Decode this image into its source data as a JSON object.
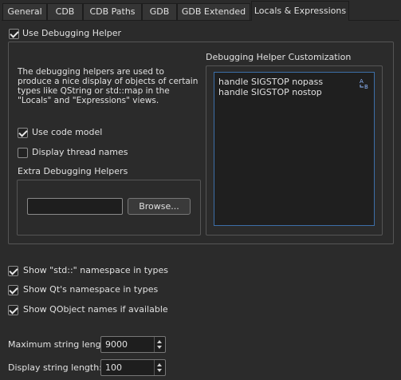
{
  "tabs": [
    {
      "label": "General"
    },
    {
      "label": "CDB"
    },
    {
      "label": "CDB Paths"
    },
    {
      "label": "GDB"
    },
    {
      "label": "GDB Extended"
    },
    {
      "label": "Locals & Expressions"
    }
  ],
  "active_tab": "Locals & Expressions",
  "use_debugging_helper": {
    "label": "Use Debugging Helper",
    "checked": true
  },
  "helpers": {
    "description": "The debugging helpers are used to produce a nice display of objects of certain types like QString or std::map in the \"Locals\" and \"Expressions\" views.",
    "use_code_model": {
      "label": "Use code model",
      "checked": true
    },
    "display_thread_names": {
      "label": "Display thread names",
      "checked": false
    },
    "extra_title": "Extra Debugging Helpers",
    "extra_path_value": "",
    "browse_label": "Browse..."
  },
  "customization": {
    "title": "Debugging Helper Customization",
    "lines": [
      "handle SIGSTOP nopass",
      "handle SIGSTOP nostop"
    ],
    "corner_icon": "text-reorder-icon"
  },
  "options": [
    {
      "label": "Show \"std::\" namespace in types",
      "checked": true
    },
    {
      "label": "Show Qt's namespace in types",
      "checked": true
    },
    {
      "label": "Show QObject names if available",
      "checked": true
    }
  ],
  "max_string_length": {
    "label": "Maximum string length:",
    "value": "9000"
  },
  "display_string_length": {
    "label": "Display string length:",
    "value": "100"
  }
}
